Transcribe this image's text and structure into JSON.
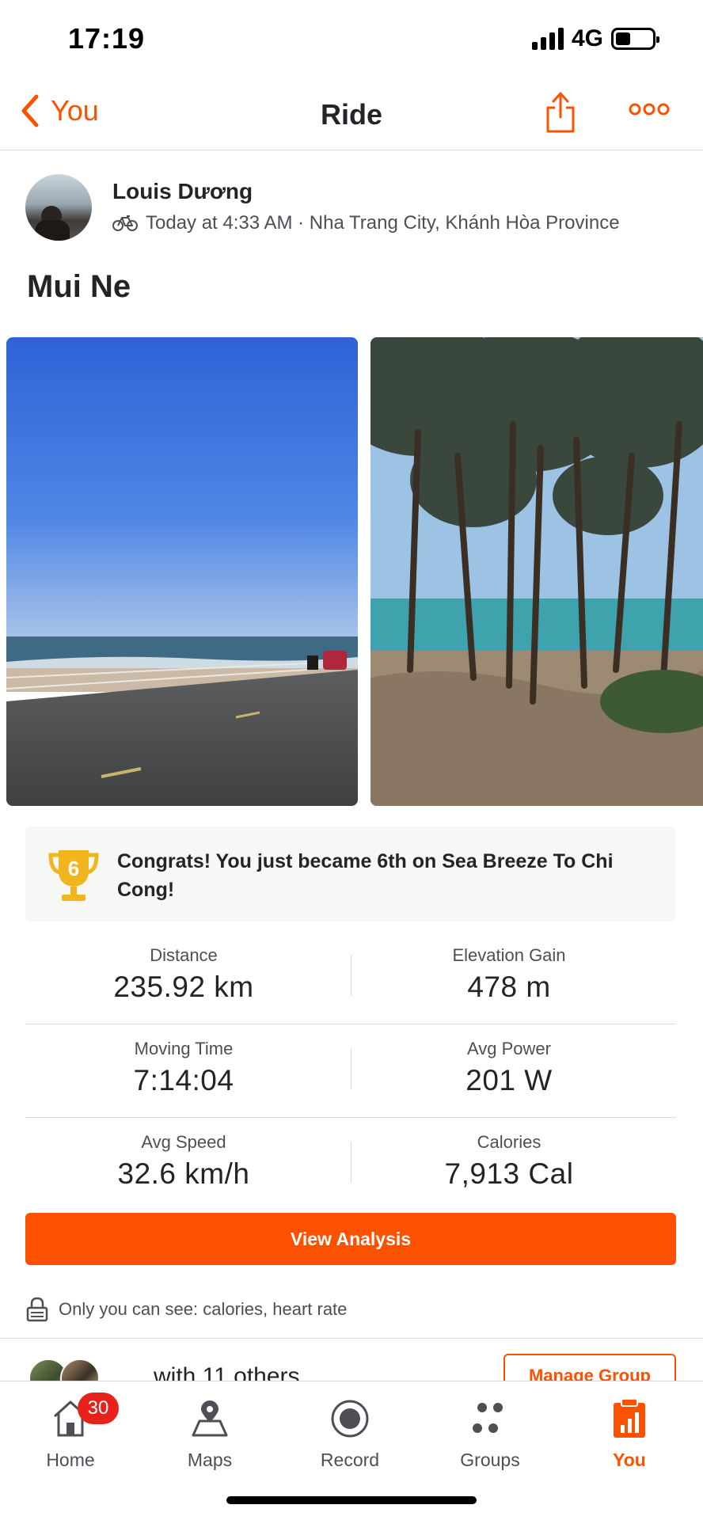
{
  "status_bar": {
    "time": "17:19",
    "network": "4G"
  },
  "nav": {
    "back_label": "You",
    "title": "Ride"
  },
  "athlete": {
    "name": "Louis Dương",
    "meta": "Today at 4:33 AM · Nha Trang City, Khánh Hòa Province"
  },
  "activity": {
    "title": "Mui Ne"
  },
  "achievement": {
    "rank": "6",
    "text": "Congrats! You just became 6th on Sea Breeze To Chi Cong!"
  },
  "stats": [
    {
      "left_label": "Distance",
      "left_value": "235.92 km",
      "right_label": "Elevation Gain",
      "right_value": "478 m"
    },
    {
      "left_label": "Moving Time",
      "left_value": "7:14:04",
      "right_label": "Avg Power",
      "right_value": "201 W"
    },
    {
      "left_label": "Avg Speed",
      "left_value": "32.6 km/h",
      "right_label": "Calories",
      "right_value": "7,913 Cal"
    }
  ],
  "analysis_button": "View Analysis",
  "privacy_note": "Only you can see: calories, heart rate",
  "group": {
    "label": "with 11 others",
    "manage_label": "Manage Group"
  },
  "tabbar": {
    "home": "Home",
    "home_badge": "30",
    "maps": "Maps",
    "record": "Record",
    "groups": "Groups",
    "you": "You"
  },
  "colors": {
    "accent": "#fc5200",
    "badge": "#e8221a",
    "text": "#242428",
    "muted": "#4e4e55"
  }
}
